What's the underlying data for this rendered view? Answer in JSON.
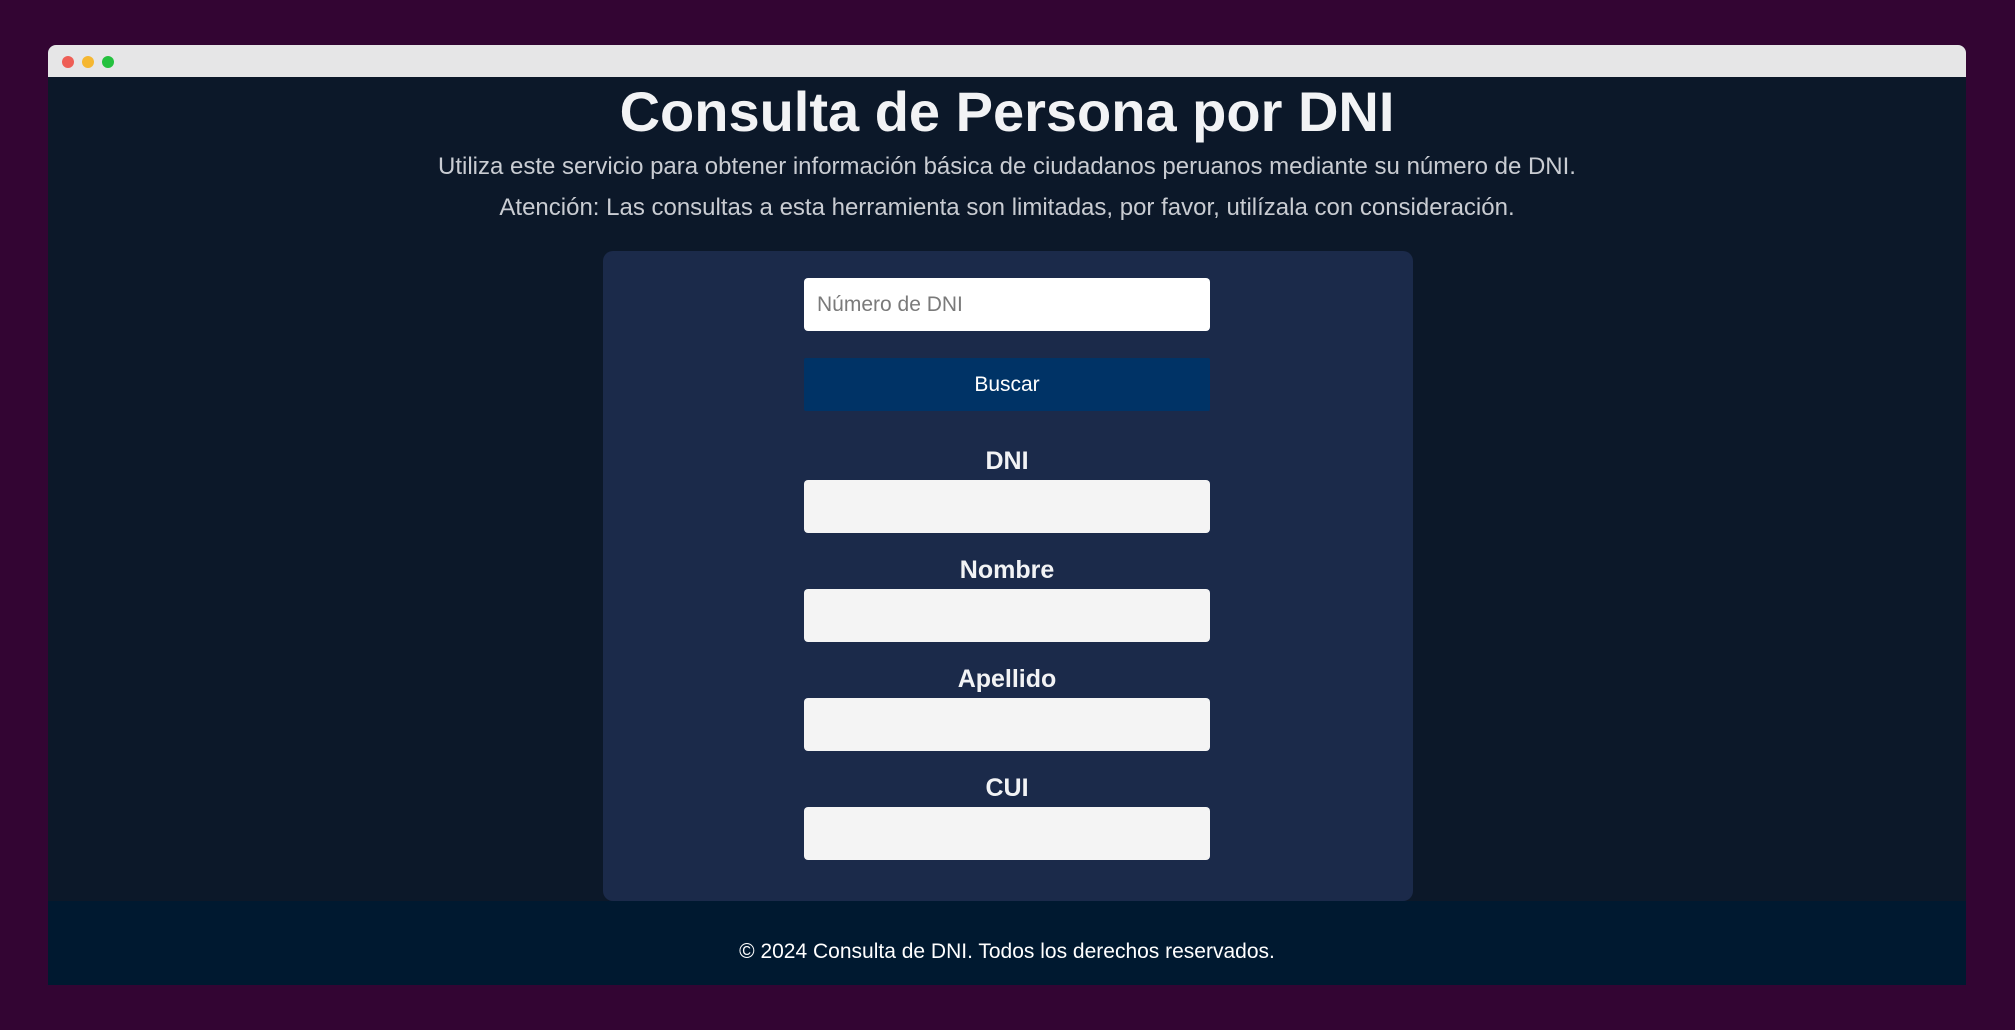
{
  "window": {
    "controls": [
      {
        "name": "close",
        "color": "#ee5e56"
      },
      {
        "name": "minimize",
        "color": "#f5b731"
      },
      {
        "name": "maximize",
        "color": "#25c13f"
      }
    ]
  },
  "header": {
    "title": "Consulta de Persona por DNI",
    "intro_line_1": "Utiliza este servicio para obtener información básica de ciudadanos peruanos mediante su número de DNI.",
    "intro_line_2": "Atención: Las consultas a esta herramienta son limitadas, por favor, utilízala con consideración."
  },
  "search": {
    "placeholder": "Número de DNI",
    "value": "",
    "button_label": "Buscar"
  },
  "results": {
    "fields": [
      {
        "label": "DNI",
        "value": ""
      },
      {
        "label": "Nombre",
        "value": ""
      },
      {
        "label": "Apellido",
        "value": ""
      },
      {
        "label": "CUI",
        "value": ""
      }
    ]
  },
  "footer": {
    "text": "© 2024 Consulta de DNI. Todos los derechos reservados."
  },
  "colors": {
    "desktop_background": "#330533",
    "page_background": "#0c1829",
    "card_background": "#1b2a4a",
    "button_background": "#003366",
    "footer_background": "#001930"
  }
}
